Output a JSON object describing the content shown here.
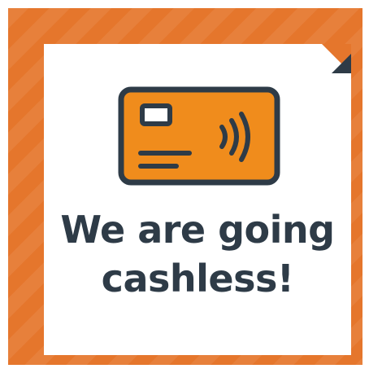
{
  "headline": {
    "line1": "We are going",
    "line2": "cashless!"
  },
  "icon": {
    "name": "contactless-card-icon",
    "card_fill": "#f08c1c",
    "outline": "#2e3b47"
  },
  "colors": {
    "frame": "#e5762c",
    "panel": "#ffffff",
    "text": "#2e3b47"
  }
}
